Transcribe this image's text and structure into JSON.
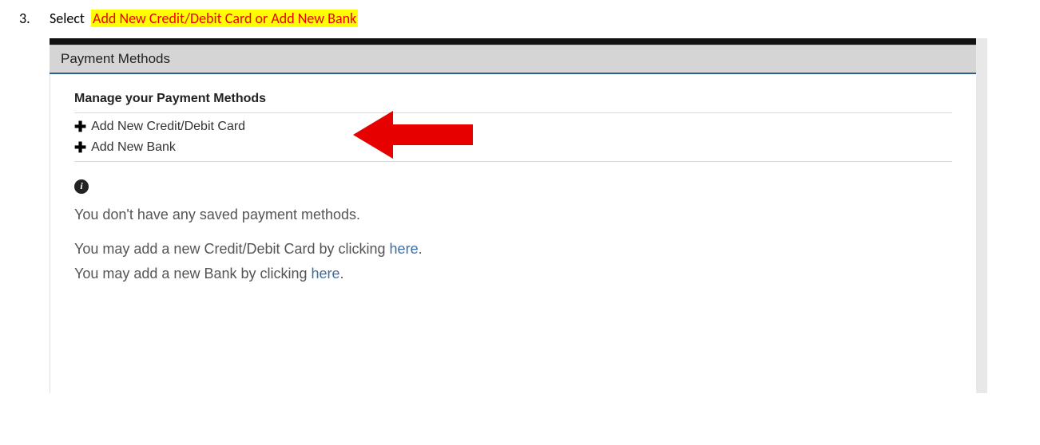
{
  "step": {
    "number": "3.",
    "word": "Select",
    "highlight": "Add New Credit/Debit Card or Add New Bank"
  },
  "panel": {
    "title": "Payment Methods",
    "section_title": "Manage your Payment Methods",
    "add_card": "Add New Credit/Debit Card",
    "add_bank": "Add New Bank",
    "info_letter": "i",
    "no_saved": "You don't have any saved payment methods.",
    "card_line_prefix": "You may add a new Credit/Debit Card by clicking ",
    "card_line_link": "here",
    "card_line_suffix": ".",
    "bank_line_prefix": "You may add a new Bank by clicking ",
    "bank_line_link": "here",
    "bank_line_suffix": "."
  }
}
